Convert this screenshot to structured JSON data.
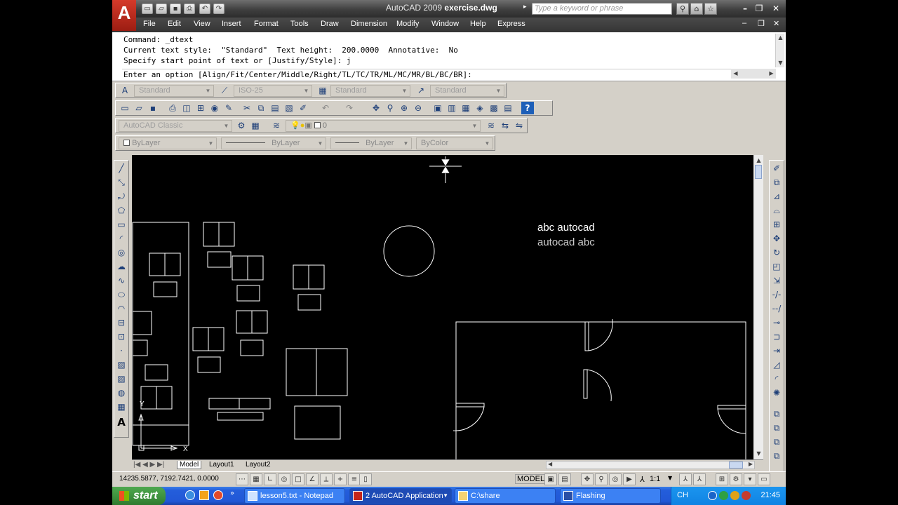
{
  "window": {
    "app_name": "AutoCAD 2009",
    "file_name": "exercise.dwg",
    "search_placeholder": "Type a keyword or phrase",
    "logo_letter": "A"
  },
  "menu": [
    "File",
    "Edit",
    "View",
    "Insert",
    "Format",
    "Tools",
    "Draw",
    "Dimension",
    "Modify",
    "Window",
    "Help",
    "Express"
  ],
  "command": {
    "history": [
      "Command: _dtext",
      "Current text style:  \"Standard\"  Text height:  200.0000  Annotative:  No",
      "Specify start point of text or [Justify/Style]: j"
    ],
    "prompt": "Enter an option [Align/Fit/Center/Middle/Right/TL/TC/TR/ML/MC/MR/BL/BC/BR]:"
  },
  "styles_toolbar": {
    "text_style": "Standard",
    "dim_style": "ISO-25",
    "table_style": "Standard",
    "multileader_style": "Standard"
  },
  "workspace": "AutoCAD Classic",
  "layer": "0",
  "properties": {
    "color": "ByLayer",
    "linetype": "ByLayer",
    "lineweight": "ByLayer",
    "plotstyle": "ByColor"
  },
  "drawing": {
    "text1": "abc autocad",
    "text2": "autocad abc",
    "ucs_y": "Y",
    "ucs_x": "X"
  },
  "layout_tabs": [
    "Model",
    "Layout1",
    "Layout2"
  ],
  "status": {
    "coordinates": "14235.5877, 7192.7421, 0.0000",
    "model": "MODEL",
    "annotation_scale": "1:1"
  },
  "taskbar": {
    "start": "start",
    "tasks": [
      "lesson5.txt - Notepad",
      "2 AutoCAD Application",
      "C:\\share",
      "Flashing"
    ],
    "language": "CH",
    "clock": "21:45"
  },
  "colors": {
    "title_bar": "#3f3f3f",
    "menu_bar": "#353535",
    "toolbar_bg": "#d4d0c8",
    "drawing_bg": "#000000",
    "taskbar": "#245edb",
    "start_green": "#3c8f3c"
  }
}
